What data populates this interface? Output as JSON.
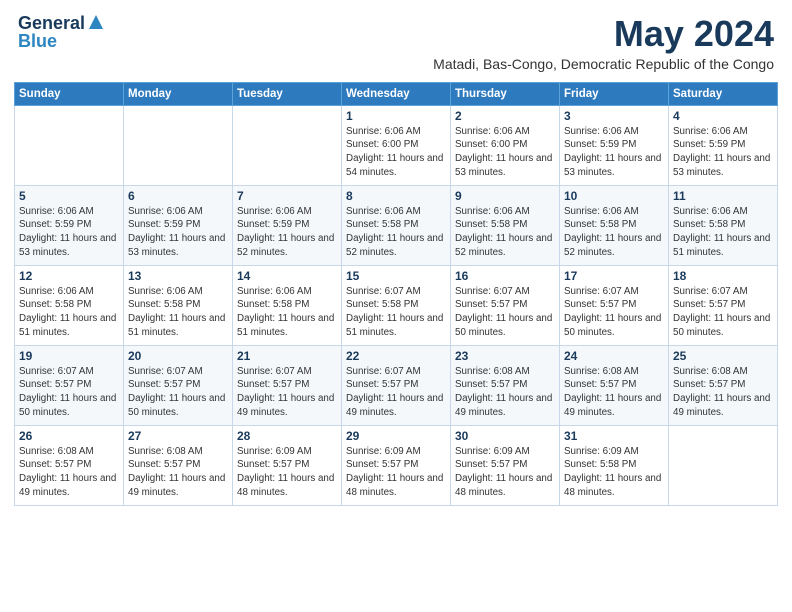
{
  "logo": {
    "general": "General",
    "blue": "Blue"
  },
  "title": {
    "month": "May 2024",
    "location": "Matadi, Bas-Congo, Democratic Republic of the Congo"
  },
  "weekdays": [
    "Sunday",
    "Monday",
    "Tuesday",
    "Wednesday",
    "Thursday",
    "Friday",
    "Saturday"
  ],
  "weeks": [
    [
      {
        "day": "",
        "info": ""
      },
      {
        "day": "",
        "info": ""
      },
      {
        "day": "",
        "info": ""
      },
      {
        "day": "1",
        "info": "Sunrise: 6:06 AM\nSunset: 6:00 PM\nDaylight: 11 hours and 54 minutes."
      },
      {
        "day": "2",
        "info": "Sunrise: 6:06 AM\nSunset: 6:00 PM\nDaylight: 11 hours and 53 minutes."
      },
      {
        "day": "3",
        "info": "Sunrise: 6:06 AM\nSunset: 5:59 PM\nDaylight: 11 hours and 53 minutes."
      },
      {
        "day": "4",
        "info": "Sunrise: 6:06 AM\nSunset: 5:59 PM\nDaylight: 11 hours and 53 minutes."
      }
    ],
    [
      {
        "day": "5",
        "info": "Sunrise: 6:06 AM\nSunset: 5:59 PM\nDaylight: 11 hours and 53 minutes."
      },
      {
        "day": "6",
        "info": "Sunrise: 6:06 AM\nSunset: 5:59 PM\nDaylight: 11 hours and 53 minutes."
      },
      {
        "day": "7",
        "info": "Sunrise: 6:06 AM\nSunset: 5:59 PM\nDaylight: 11 hours and 52 minutes."
      },
      {
        "day": "8",
        "info": "Sunrise: 6:06 AM\nSunset: 5:58 PM\nDaylight: 11 hours and 52 minutes."
      },
      {
        "day": "9",
        "info": "Sunrise: 6:06 AM\nSunset: 5:58 PM\nDaylight: 11 hours and 52 minutes."
      },
      {
        "day": "10",
        "info": "Sunrise: 6:06 AM\nSunset: 5:58 PM\nDaylight: 11 hours and 52 minutes."
      },
      {
        "day": "11",
        "info": "Sunrise: 6:06 AM\nSunset: 5:58 PM\nDaylight: 11 hours and 51 minutes."
      }
    ],
    [
      {
        "day": "12",
        "info": "Sunrise: 6:06 AM\nSunset: 5:58 PM\nDaylight: 11 hours and 51 minutes."
      },
      {
        "day": "13",
        "info": "Sunrise: 6:06 AM\nSunset: 5:58 PM\nDaylight: 11 hours and 51 minutes."
      },
      {
        "day": "14",
        "info": "Sunrise: 6:06 AM\nSunset: 5:58 PM\nDaylight: 11 hours and 51 minutes."
      },
      {
        "day": "15",
        "info": "Sunrise: 6:07 AM\nSunset: 5:58 PM\nDaylight: 11 hours and 51 minutes."
      },
      {
        "day": "16",
        "info": "Sunrise: 6:07 AM\nSunset: 5:57 PM\nDaylight: 11 hours and 50 minutes."
      },
      {
        "day": "17",
        "info": "Sunrise: 6:07 AM\nSunset: 5:57 PM\nDaylight: 11 hours and 50 minutes."
      },
      {
        "day": "18",
        "info": "Sunrise: 6:07 AM\nSunset: 5:57 PM\nDaylight: 11 hours and 50 minutes."
      }
    ],
    [
      {
        "day": "19",
        "info": "Sunrise: 6:07 AM\nSunset: 5:57 PM\nDaylight: 11 hours and 50 minutes."
      },
      {
        "day": "20",
        "info": "Sunrise: 6:07 AM\nSunset: 5:57 PM\nDaylight: 11 hours and 50 minutes."
      },
      {
        "day": "21",
        "info": "Sunrise: 6:07 AM\nSunset: 5:57 PM\nDaylight: 11 hours and 49 minutes."
      },
      {
        "day": "22",
        "info": "Sunrise: 6:07 AM\nSunset: 5:57 PM\nDaylight: 11 hours and 49 minutes."
      },
      {
        "day": "23",
        "info": "Sunrise: 6:08 AM\nSunset: 5:57 PM\nDaylight: 11 hours and 49 minutes."
      },
      {
        "day": "24",
        "info": "Sunrise: 6:08 AM\nSunset: 5:57 PM\nDaylight: 11 hours and 49 minutes."
      },
      {
        "day": "25",
        "info": "Sunrise: 6:08 AM\nSunset: 5:57 PM\nDaylight: 11 hours and 49 minutes."
      }
    ],
    [
      {
        "day": "26",
        "info": "Sunrise: 6:08 AM\nSunset: 5:57 PM\nDaylight: 11 hours and 49 minutes."
      },
      {
        "day": "27",
        "info": "Sunrise: 6:08 AM\nSunset: 5:57 PM\nDaylight: 11 hours and 49 minutes."
      },
      {
        "day": "28",
        "info": "Sunrise: 6:09 AM\nSunset: 5:57 PM\nDaylight: 11 hours and 48 minutes."
      },
      {
        "day": "29",
        "info": "Sunrise: 6:09 AM\nSunset: 5:57 PM\nDaylight: 11 hours and 48 minutes."
      },
      {
        "day": "30",
        "info": "Sunrise: 6:09 AM\nSunset: 5:57 PM\nDaylight: 11 hours and 48 minutes."
      },
      {
        "day": "31",
        "info": "Sunrise: 6:09 AM\nSunset: 5:58 PM\nDaylight: 11 hours and 48 minutes."
      },
      {
        "day": "",
        "info": ""
      }
    ]
  ]
}
